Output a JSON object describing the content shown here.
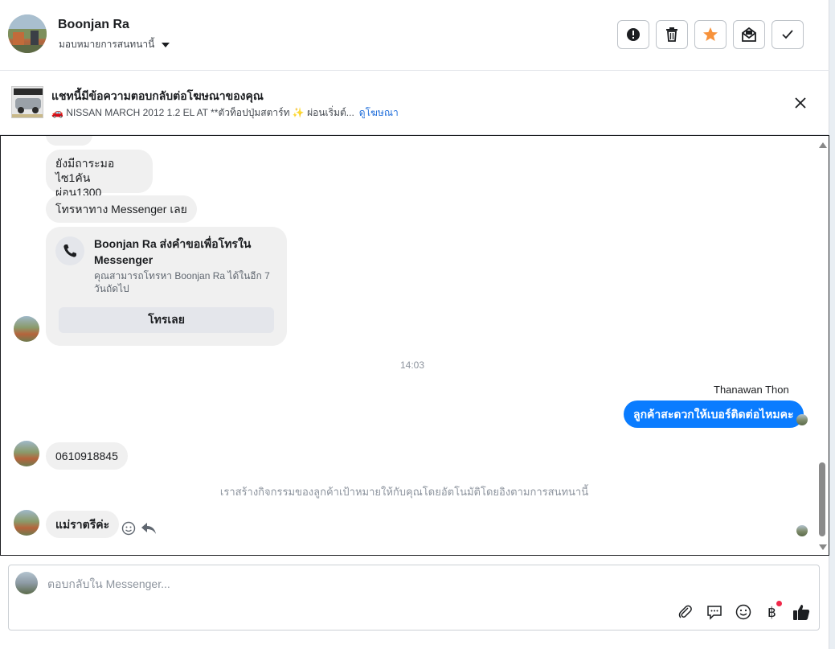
{
  "header": {
    "contact_name": "Boonjan Ra",
    "assign_label": "มอบหมายการสนทนานี้",
    "actions": [
      {
        "name": "report-button",
        "icon": "alert-icon"
      },
      {
        "name": "delete-button",
        "icon": "trash-icon"
      },
      {
        "name": "star-button",
        "icon": "star-icon",
        "color": "#f7923b"
      },
      {
        "name": "mark-unread-button",
        "icon": "envelope-icon"
      },
      {
        "name": "done-button",
        "icon": "checkmark-icon"
      }
    ]
  },
  "ad_banner": {
    "title": "แชทนี้มีข้อความตอบกลับต่อโฆษณาของคุณ",
    "subtitle": "🚗 NISSAN MARCH 2012 1.2 EL AT **ตัวท็อปปุ่มสตาร์ท ✨ ผ่อนเริ่มต์...",
    "link": "ดูโฆษณา"
  },
  "messages": {
    "msg1": "ยังมีถาระมอไซ1คัน",
    "msg1b": "ผ่อน1300",
    "msg2": "โทรหาทาง Messenger เลย",
    "call_card": {
      "title": "Boonjan Ra ส่งคำขอเพื่อโทรใน Messenger",
      "desc": "คุณสามารถโทรหา Boonjan Ra ได้ในอีก 7 วันถัดไป",
      "button": "โทรเลย"
    },
    "timestamp": "14:03",
    "sender_name": "Thanawan Thon",
    "outgoing": "ลูกค้าสะดวกให้เบอร์ติดต่อไหมคะ",
    "phone": "0610918845",
    "system_note": "เราสร้างกิจกรรมของลูกค้าเป้าหมายให้กับคุณโดยอัตโนมัติโดยอิงตามการสนทนานี้",
    "last": "แม่ราตรีค่ะ"
  },
  "composer": {
    "placeholder": "ตอบกลับใน Messenger...",
    "tools": [
      "attach-icon",
      "quick-reply-icon",
      "emoji-icon",
      "baht-icon",
      "thumbs-up-icon"
    ],
    "accent": "#0a7cff"
  }
}
